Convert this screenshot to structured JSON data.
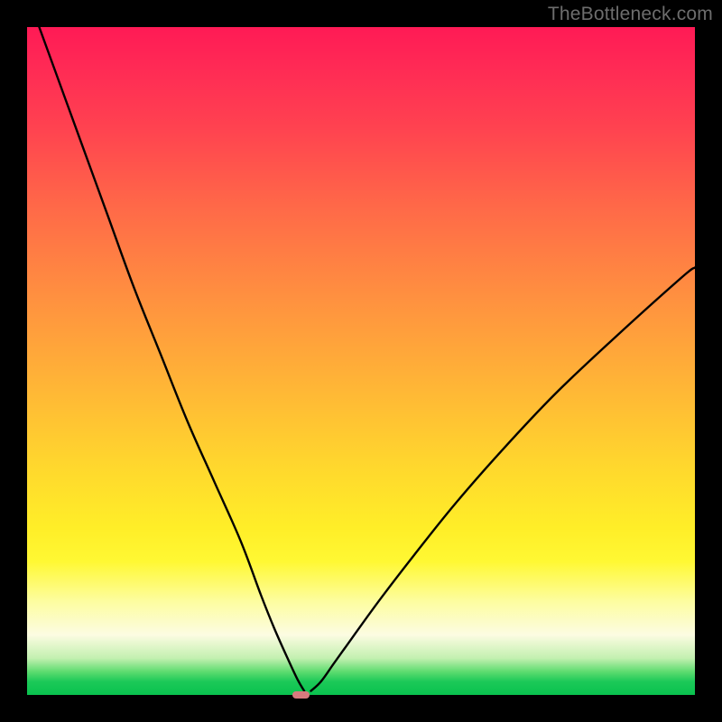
{
  "watermark": {
    "text": "TheBottleneck.com"
  },
  "colors": {
    "frame": "#000000",
    "marker": "#d77a7e",
    "curve": "#000000",
    "gradient_stops": [
      "#ff1a55",
      "#ff2a55",
      "#ff4250",
      "#ff6948",
      "#ff8f40",
      "#ffb636",
      "#ffd82d",
      "#ffee28",
      "#fff833",
      "#fdfda0",
      "#fcfce2",
      "#c3f0b0",
      "#5edc70",
      "#1cc958",
      "#09c24e"
    ]
  },
  "chart_data": {
    "type": "line",
    "title": "",
    "xlabel": "",
    "ylabel": "",
    "xlim": [
      0,
      100
    ],
    "ylim": [
      0,
      100
    ],
    "grid": false,
    "legend": false,
    "marker": {
      "x": 41,
      "y": 0,
      "w": 2.5,
      "h": 1.2
    },
    "series": [
      {
        "name": "left-branch",
        "x": [
          0,
          4,
          8,
          12,
          16,
          20,
          24,
          28,
          32,
          35,
          37,
          39,
          40.5,
          41.5
        ],
        "y": [
          105,
          94,
          83,
          72,
          61,
          51,
          41,
          32,
          23,
          15,
          10,
          5.5,
          2.3,
          0.6
        ]
      },
      {
        "name": "right-branch",
        "x": [
          42.5,
          44,
          46,
          49,
          53,
          58,
          64,
          71,
          79,
          88,
          98,
          100
        ],
        "y": [
          0.6,
          2.0,
          4.8,
          9.0,
          14.5,
          21.0,
          28.5,
          36.5,
          45.0,
          53.5,
          62.5,
          64.0
        ]
      }
    ]
  }
}
